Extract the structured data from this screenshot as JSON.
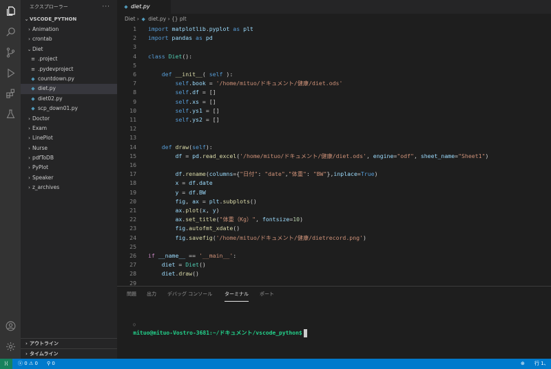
{
  "sidebar": {
    "title": "エクスプローラー",
    "more": "···",
    "root": "VSCODE_PYTHON",
    "tree": [
      {
        "label": "Animation",
        "type": "folder",
        "open": false,
        "depth": 0
      },
      {
        "label": "crontab",
        "type": "folder",
        "open": false,
        "depth": 0
      },
      {
        "label": "Diet",
        "type": "folder",
        "open": true,
        "depth": 0
      },
      {
        "label": ".project",
        "type": "file-txt",
        "depth": 1
      },
      {
        "label": ".pydevproject",
        "type": "file-txt",
        "depth": 1
      },
      {
        "label": "countdown.py",
        "type": "file-py",
        "depth": 1
      },
      {
        "label": "diet.py",
        "type": "file-py",
        "depth": 1,
        "selected": true
      },
      {
        "label": "diet02.py",
        "type": "file-py",
        "depth": 1
      },
      {
        "label": "scp_down01.py",
        "type": "file-py",
        "depth": 1
      },
      {
        "label": "Doctor",
        "type": "folder",
        "open": false,
        "depth": 0
      },
      {
        "label": "Exam",
        "type": "folder",
        "open": false,
        "depth": 0
      },
      {
        "label": "LinePlot",
        "type": "folder",
        "open": false,
        "depth": 0
      },
      {
        "label": "Nurse",
        "type": "folder",
        "open": false,
        "depth": 0
      },
      {
        "label": "pdfToDB",
        "type": "folder",
        "open": false,
        "depth": 0
      },
      {
        "label": "PyPlot",
        "type": "folder",
        "open": false,
        "depth": 0
      },
      {
        "label": "Speaker",
        "type": "folder",
        "open": false,
        "depth": 0
      },
      {
        "label": "z_archives",
        "type": "folder",
        "open": false,
        "depth": 0
      }
    ],
    "outline": "アウトライン",
    "timeline": "タイムライン"
  },
  "tab": {
    "label": "diet.py"
  },
  "breadcrumb": {
    "folder": "Diet",
    "file": "diet.py",
    "symbol": "{} plt"
  },
  "code": [
    "import matplotlib.pyplot as plt",
    "import pandas as pd",
    "",
    "class Diet():",
    "",
    "    def __init__( self ):",
    "        self.book = '/home/mituo/ドキュメント/健康/diet.ods'",
    "        self.df = []",
    "        self.xs = []",
    "        self.ys1 = []",
    "        self.ys2 = []",
    "",
    "",
    "    def draw(self):",
    "        df = pd.read_excel('/home/mituo/ドキュメント/健康/diet.ods', engine=\"odf\", sheet_name=\"Sheet1\")",
    "",
    "        df.rename(columns={\"日付\": \"date\",\"体重\": \"BW\"},inplace=True)",
    "        x = df.date",
    "        y = df.BW",
    "        fig, ax = plt.subplots()",
    "        ax.plot(x, y)",
    "        ax.set_title(\"体重（Kg）\", fontsize=10)",
    "        fig.autofmt_xdate()",
    "        fig.savefig('/home/mituo/ドキュメント/健康/dietrecord.png')",
    "",
    "if __name__ == '__main__':",
    "    diet = Diet()",
    "    diet.draw()",
    ""
  ],
  "panel": {
    "tabs": [
      "問題",
      "出力",
      "デバッグ コンソール",
      "ターミナル",
      "ポート"
    ],
    "active_tab": "ターミナル",
    "terminal_prompt": "mituo@mituo-Vostro-3681:~/ドキュメント/vscode_python$"
  },
  "status": {
    "errors": "0",
    "warnings": "0",
    "ports": "0",
    "position": "行 1、"
  }
}
